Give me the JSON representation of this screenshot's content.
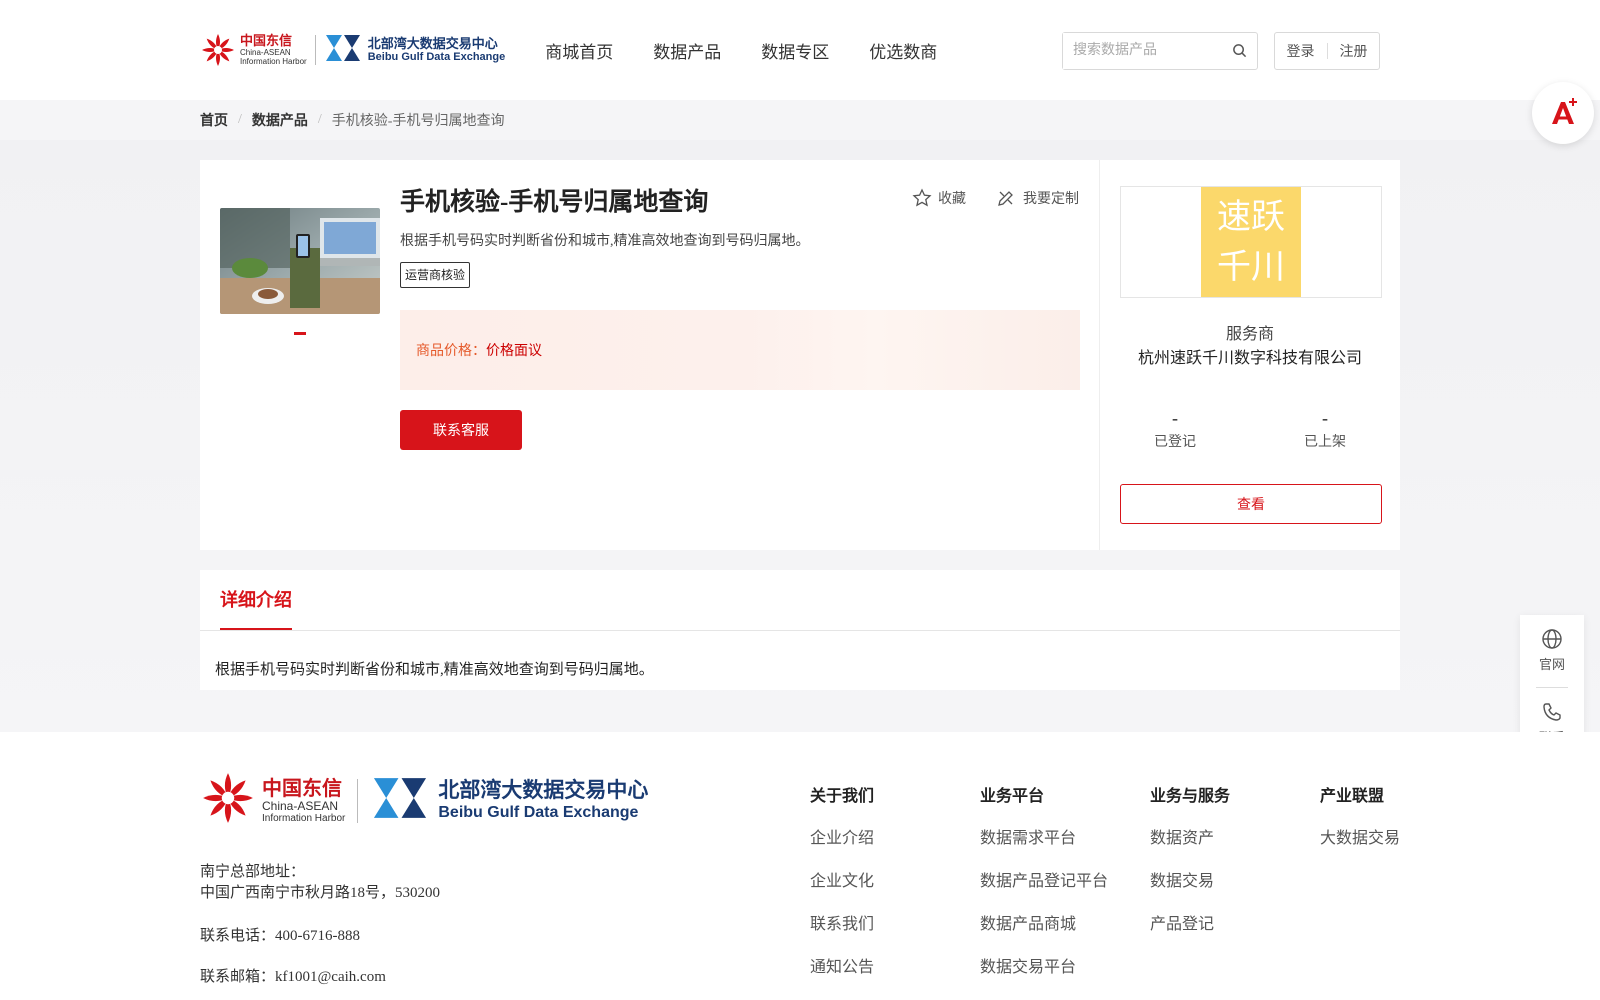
{
  "header": {
    "logo_cn": "中国东信",
    "logo_en1": "China-ASEAN",
    "logo_en2": "Information Harbor",
    "logo2_cn": "北部湾大数据交易中心",
    "logo2_en": "Beibu Gulf Data Exchange",
    "nav": [
      "商城首页",
      "数据产品",
      "数据专区",
      "优选数商"
    ],
    "search_placeholder": "搜索数据产品",
    "login": "登录",
    "register": "注册"
  },
  "breadcrumb": [
    "首页",
    "数据产品",
    "手机核验-手机号归属地查询"
  ],
  "product": {
    "title": "手机核验-手机号归属地查询",
    "favorite": "收藏",
    "customize": "我要定制",
    "description": "根据手机号码实时判断省份和城市,精准高效地查询到号码归属地。",
    "tag": "运营商核验",
    "price_label": "商品价格：",
    "price_value": "价格面议",
    "contact_button": "联系客服"
  },
  "provider": {
    "logo_line1": "速跃",
    "logo_line2": "千川",
    "role": "服务商",
    "name": "杭州速跃千川数字科技有限公司",
    "stats": [
      {
        "value": "-",
        "label": "已登记"
      },
      {
        "value": "-",
        "label": "已上架"
      }
    ],
    "view_button": "查看"
  },
  "detail": {
    "tab": "详细介绍",
    "text": "根据手机号码实时判断省份和城市,精准高效地查询到号码归属地。"
  },
  "side": {
    "website": "官网",
    "contact": "联系"
  },
  "footer": {
    "address_label": "南宁总部地址：",
    "address": "中国广西南宁市秋月路18号，530200",
    "phone": "联系电话：400-6716-888",
    "email": "联系邮箱：kf1001@caih.com",
    "columns": [
      {
        "title": "关于我们",
        "items": [
          "企业介绍",
          "企业文化",
          "联系我们",
          "通知公告"
        ]
      },
      {
        "title": "业务平台",
        "items": [
          "数据需求平台",
          "数据产品登记平台",
          "数据产品商城",
          "数据交易平台"
        ]
      },
      {
        "title": "业务与服务",
        "items": [
          "数据资产",
          "数据交易",
          "产品登记"
        ]
      },
      {
        "title": "产业联盟",
        "items": [
          "大数据交易"
        ]
      }
    ]
  },
  "colors": {
    "accent": "#d7141a",
    "price_label": "#e55a2b",
    "provider_logo_bg": "#fbd86b"
  }
}
